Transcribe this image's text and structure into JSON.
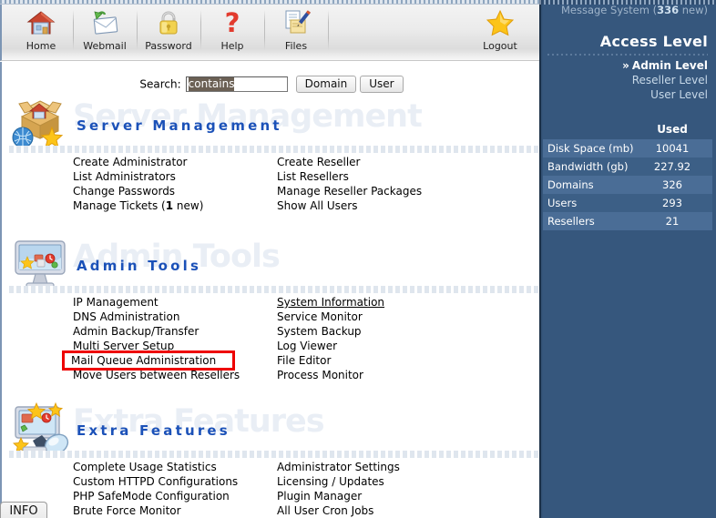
{
  "toolbar": {
    "items": [
      {
        "label": "Home",
        "icon": "home-icon"
      },
      {
        "label": "Webmail",
        "icon": "envelope-icon"
      },
      {
        "label": "Password",
        "icon": "padlock-icon"
      },
      {
        "label": "Help",
        "icon": "question-mark-icon"
      },
      {
        "label": "Files",
        "icon": "file-pencil-icon"
      },
      {
        "label": "Logout",
        "icon": "star-icon"
      }
    ]
  },
  "search": {
    "label": "Search:",
    "value": "contains",
    "domain_button": "Domain",
    "user_button": "User"
  },
  "sections": [
    {
      "title": "Server Management",
      "icon": "open-box-globe-star-icon",
      "left_links": [
        {
          "text": "Create Administrator"
        },
        {
          "text": "List Administrators"
        },
        {
          "text": "Change Passwords"
        },
        {
          "text": "Manage Tickets (",
          "bold": "1",
          "suffix": " new)"
        }
      ],
      "right_links": [
        {
          "text": "Create Reseller"
        },
        {
          "text": "List Resellers"
        },
        {
          "text": "Manage Reseller Packages"
        },
        {
          "text": "Show All Users"
        }
      ]
    },
    {
      "title": "Admin Tools",
      "icon": "monitor-tools-icon",
      "left_links": [
        {
          "text": "IP Management"
        },
        {
          "text": "DNS Administration"
        },
        {
          "text": "Admin Backup/Transfer"
        },
        {
          "text": "Multi Server Setup"
        },
        {
          "text": "Mail Queue Administration"
        },
        {
          "text": "Move Users between Resellers"
        }
      ],
      "right_links": [
        {
          "text": "System Information",
          "hover": true
        },
        {
          "text": "Service Monitor"
        },
        {
          "text": "System Backup"
        },
        {
          "text": "Log Viewer"
        },
        {
          "text": "File Editor"
        },
        {
          "text": "Process Monitor"
        }
      ]
    },
    {
      "title": "Extra Features",
      "icon": "monitor-stars-magnifier-icon",
      "left_links": [
        {
          "text": "Complete Usage Statistics"
        },
        {
          "text": "Custom HTTPD Configurations"
        },
        {
          "text": "PHP SafeMode Configuration"
        },
        {
          "text": "Brute Force Monitor"
        }
      ],
      "right_links": [
        {
          "text": "Administrator Settings"
        },
        {
          "text": "Licensing / Updates"
        },
        {
          "text": "Plugin Manager"
        },
        {
          "text": "All User Cron Jobs"
        }
      ]
    }
  ],
  "highlight": {
    "label": "Mail Queue Administration",
    "color": "#ee0000"
  },
  "info_tab": {
    "label": "INFO"
  },
  "sidebar": {
    "message_system": {
      "prefix": "Message System (",
      "count": "336",
      "suffix": " new)"
    },
    "access_level_title": "Access Level",
    "levels": [
      {
        "label": "Admin Level",
        "active": true,
        "chevron": "»"
      },
      {
        "label": "Reseller Level",
        "active": false,
        "chevron": ""
      },
      {
        "label": "User Level",
        "active": false,
        "chevron": ""
      }
    ],
    "stats": {
      "header": "Used",
      "rows": [
        {
          "name": "Disk Space (mb)",
          "value": "10041"
        },
        {
          "name": "Bandwidth (gb)",
          "value": "227.92"
        },
        {
          "name": "Domains",
          "value": "326"
        },
        {
          "name": "Users",
          "value": "293"
        },
        {
          "name": "Resellers",
          "value": "21"
        }
      ]
    },
    "colors": {
      "background": "#36577d",
      "row_odd": "#4a6d96",
      "row_even": "#3c5f86"
    }
  }
}
